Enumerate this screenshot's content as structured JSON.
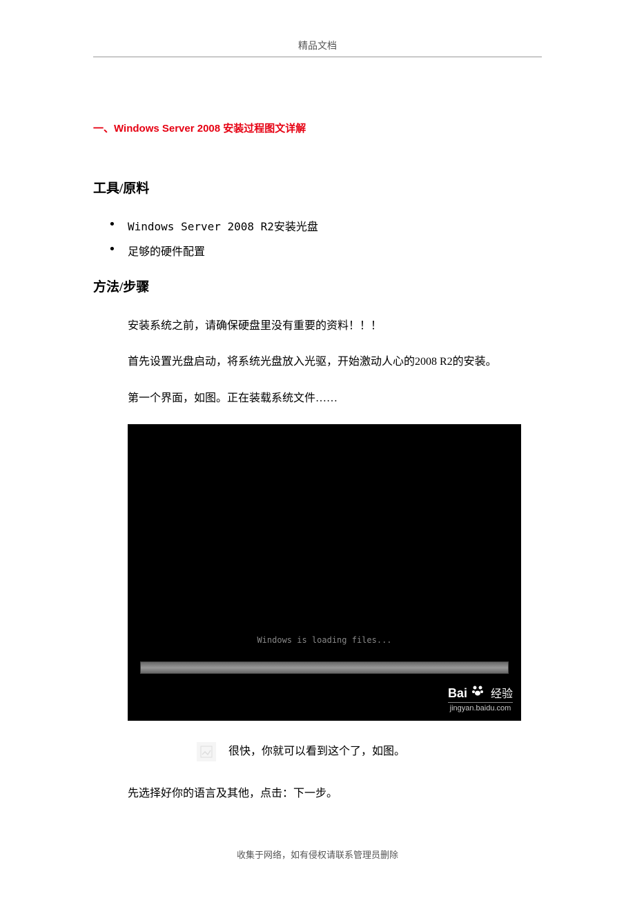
{
  "header": "精品文档",
  "title": {
    "prefix": "一、",
    "text": "Windows Server 2008 安装过程图文详解"
  },
  "section1": {
    "heading": "工具/原料",
    "items": [
      "Windows Server 2008 R2安装光盘",
      "足够的硬件配置"
    ]
  },
  "section2": {
    "heading": "方法/步骤",
    "paragraphs": [
      "安装系统之前，请确保硬盘里没有重要的资料！！！",
      "首先设置光盘启动，将系统光盘放入光驱，开始激动人心的2008 R2的安装。",
      "第一个界面，如图。正在装载系统文件……"
    ]
  },
  "screenshot": {
    "loading_text": "Windows is loading files...",
    "watermark_logo_1": "Bai",
    "watermark_logo_2": "经验",
    "watermark_url": "jingyan.baidu.com"
  },
  "after_screenshot": {
    "line1": "很快，你就可以看到这个了，如图。",
    "line2": "先选择好你的语言及其他，点击：下一步。"
  },
  "footer": "收集于网络，如有侵权请联系管理员删除"
}
